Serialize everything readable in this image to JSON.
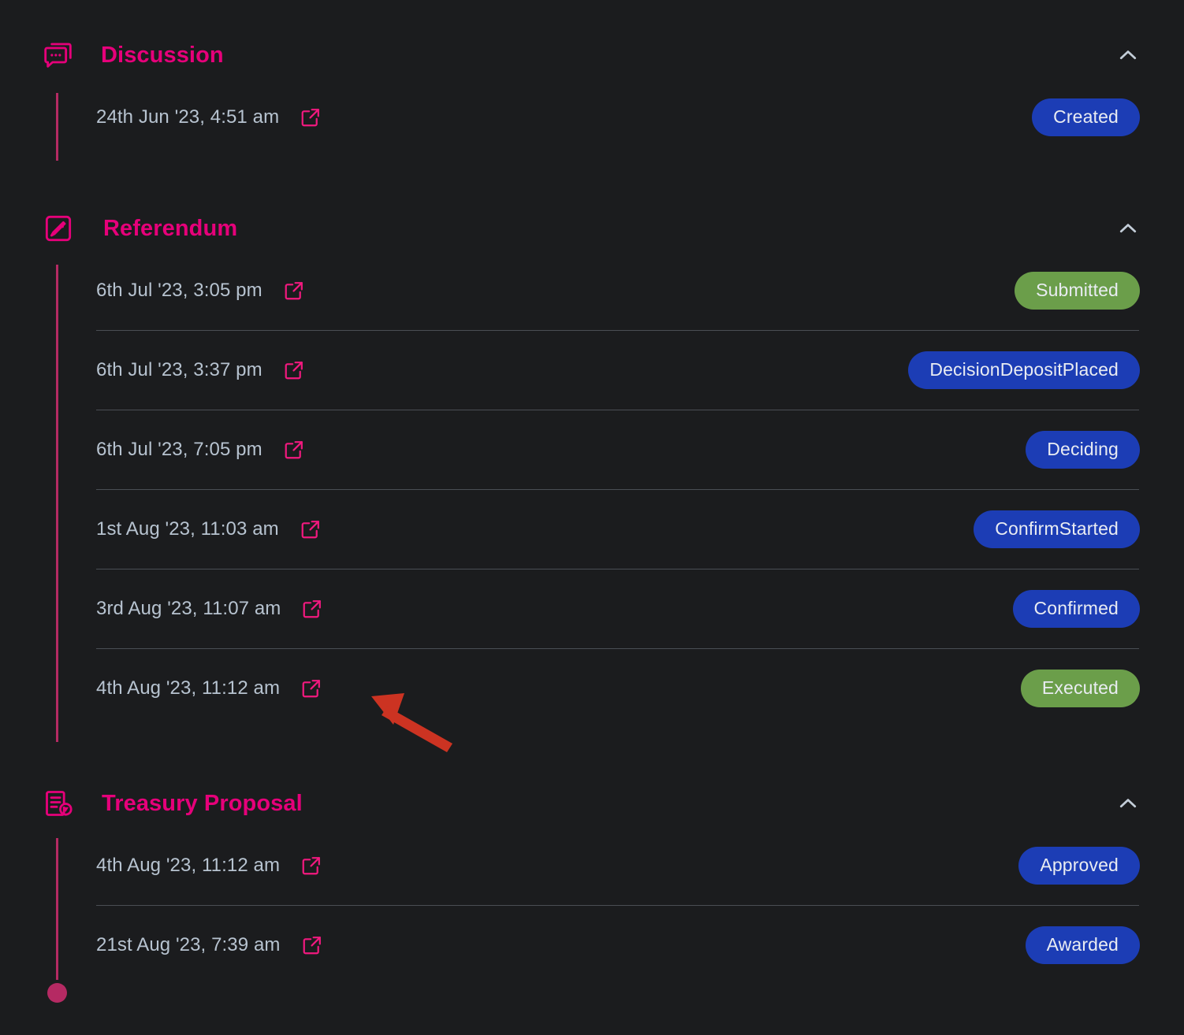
{
  "sections": [
    {
      "id": "discussion",
      "title": "Discussion",
      "icon": "chat-bubbles-icon",
      "collapse_icon": "chevron-up-icon",
      "expanded": true,
      "rows": [
        {
          "date": "24th Jun '23, 4:51 am",
          "link_icon": "external-link-icon",
          "status": "Created",
          "status_color": "#1c3db5",
          "status_variant": "blue"
        }
      ]
    },
    {
      "id": "referendum",
      "title": "Referendum",
      "icon": "edit-square-icon",
      "collapse_icon": "chevron-up-icon",
      "expanded": true,
      "rows": [
        {
          "date": "6th Jul '23, 3:05 pm",
          "link_icon": "external-link-icon",
          "status": "Submitted",
          "status_color": "#6b9e4a",
          "status_variant": "green"
        },
        {
          "date": "6th Jul '23, 3:37 pm",
          "link_icon": "external-link-icon",
          "status": "DecisionDepositPlaced",
          "status_color": "#1c3db5",
          "status_variant": "blue"
        },
        {
          "date": "6th Jul '23, 7:05 pm",
          "link_icon": "external-link-icon",
          "status": "Deciding",
          "status_color": "#1c3db5",
          "status_variant": "blue"
        },
        {
          "date": "1st Aug '23, 11:03 am",
          "link_icon": "external-link-icon",
          "status": "ConfirmStarted",
          "status_color": "#1c3db5",
          "status_variant": "blue"
        },
        {
          "date": "3rd Aug '23, 11:07 am",
          "link_icon": "external-link-icon",
          "status": "Confirmed",
          "status_color": "#1c3db5",
          "status_variant": "blue"
        },
        {
          "date": "4th Aug '23, 11:12 am",
          "link_icon": "external-link-icon",
          "status": "Executed",
          "status_color": "#6b9e4a",
          "status_variant": "green"
        }
      ]
    },
    {
      "id": "treasury",
      "title": "Treasury Proposal",
      "icon": "treasury-document-icon",
      "collapse_icon": "chevron-up-icon",
      "expanded": true,
      "rows": [
        {
          "date": "4th Aug '23, 11:12 am",
          "link_icon": "external-link-icon",
          "status": "Approved",
          "status_color": "#1c3db5",
          "status_variant": "blue"
        },
        {
          "date": "21st Aug '23, 7:39 am",
          "link_icon": "external-link-icon",
          "status": "Awarded",
          "status_color": "#1c3db5",
          "status_variant": "blue"
        }
      ]
    }
  ],
  "annotation": {
    "type": "arrow",
    "color": "#cc3322",
    "points_to": "external-link-icon of Executed row"
  },
  "theme": {
    "background": "#1b1c1e",
    "accent_pink": "#e6007a",
    "timeline_line": "#b52a63",
    "date_text": "#b7c3d0",
    "divider": "#4a4e54",
    "badge_blue": "#1c3db5",
    "badge_green": "#6b9e4a",
    "chevron": "#c3cdd8"
  }
}
